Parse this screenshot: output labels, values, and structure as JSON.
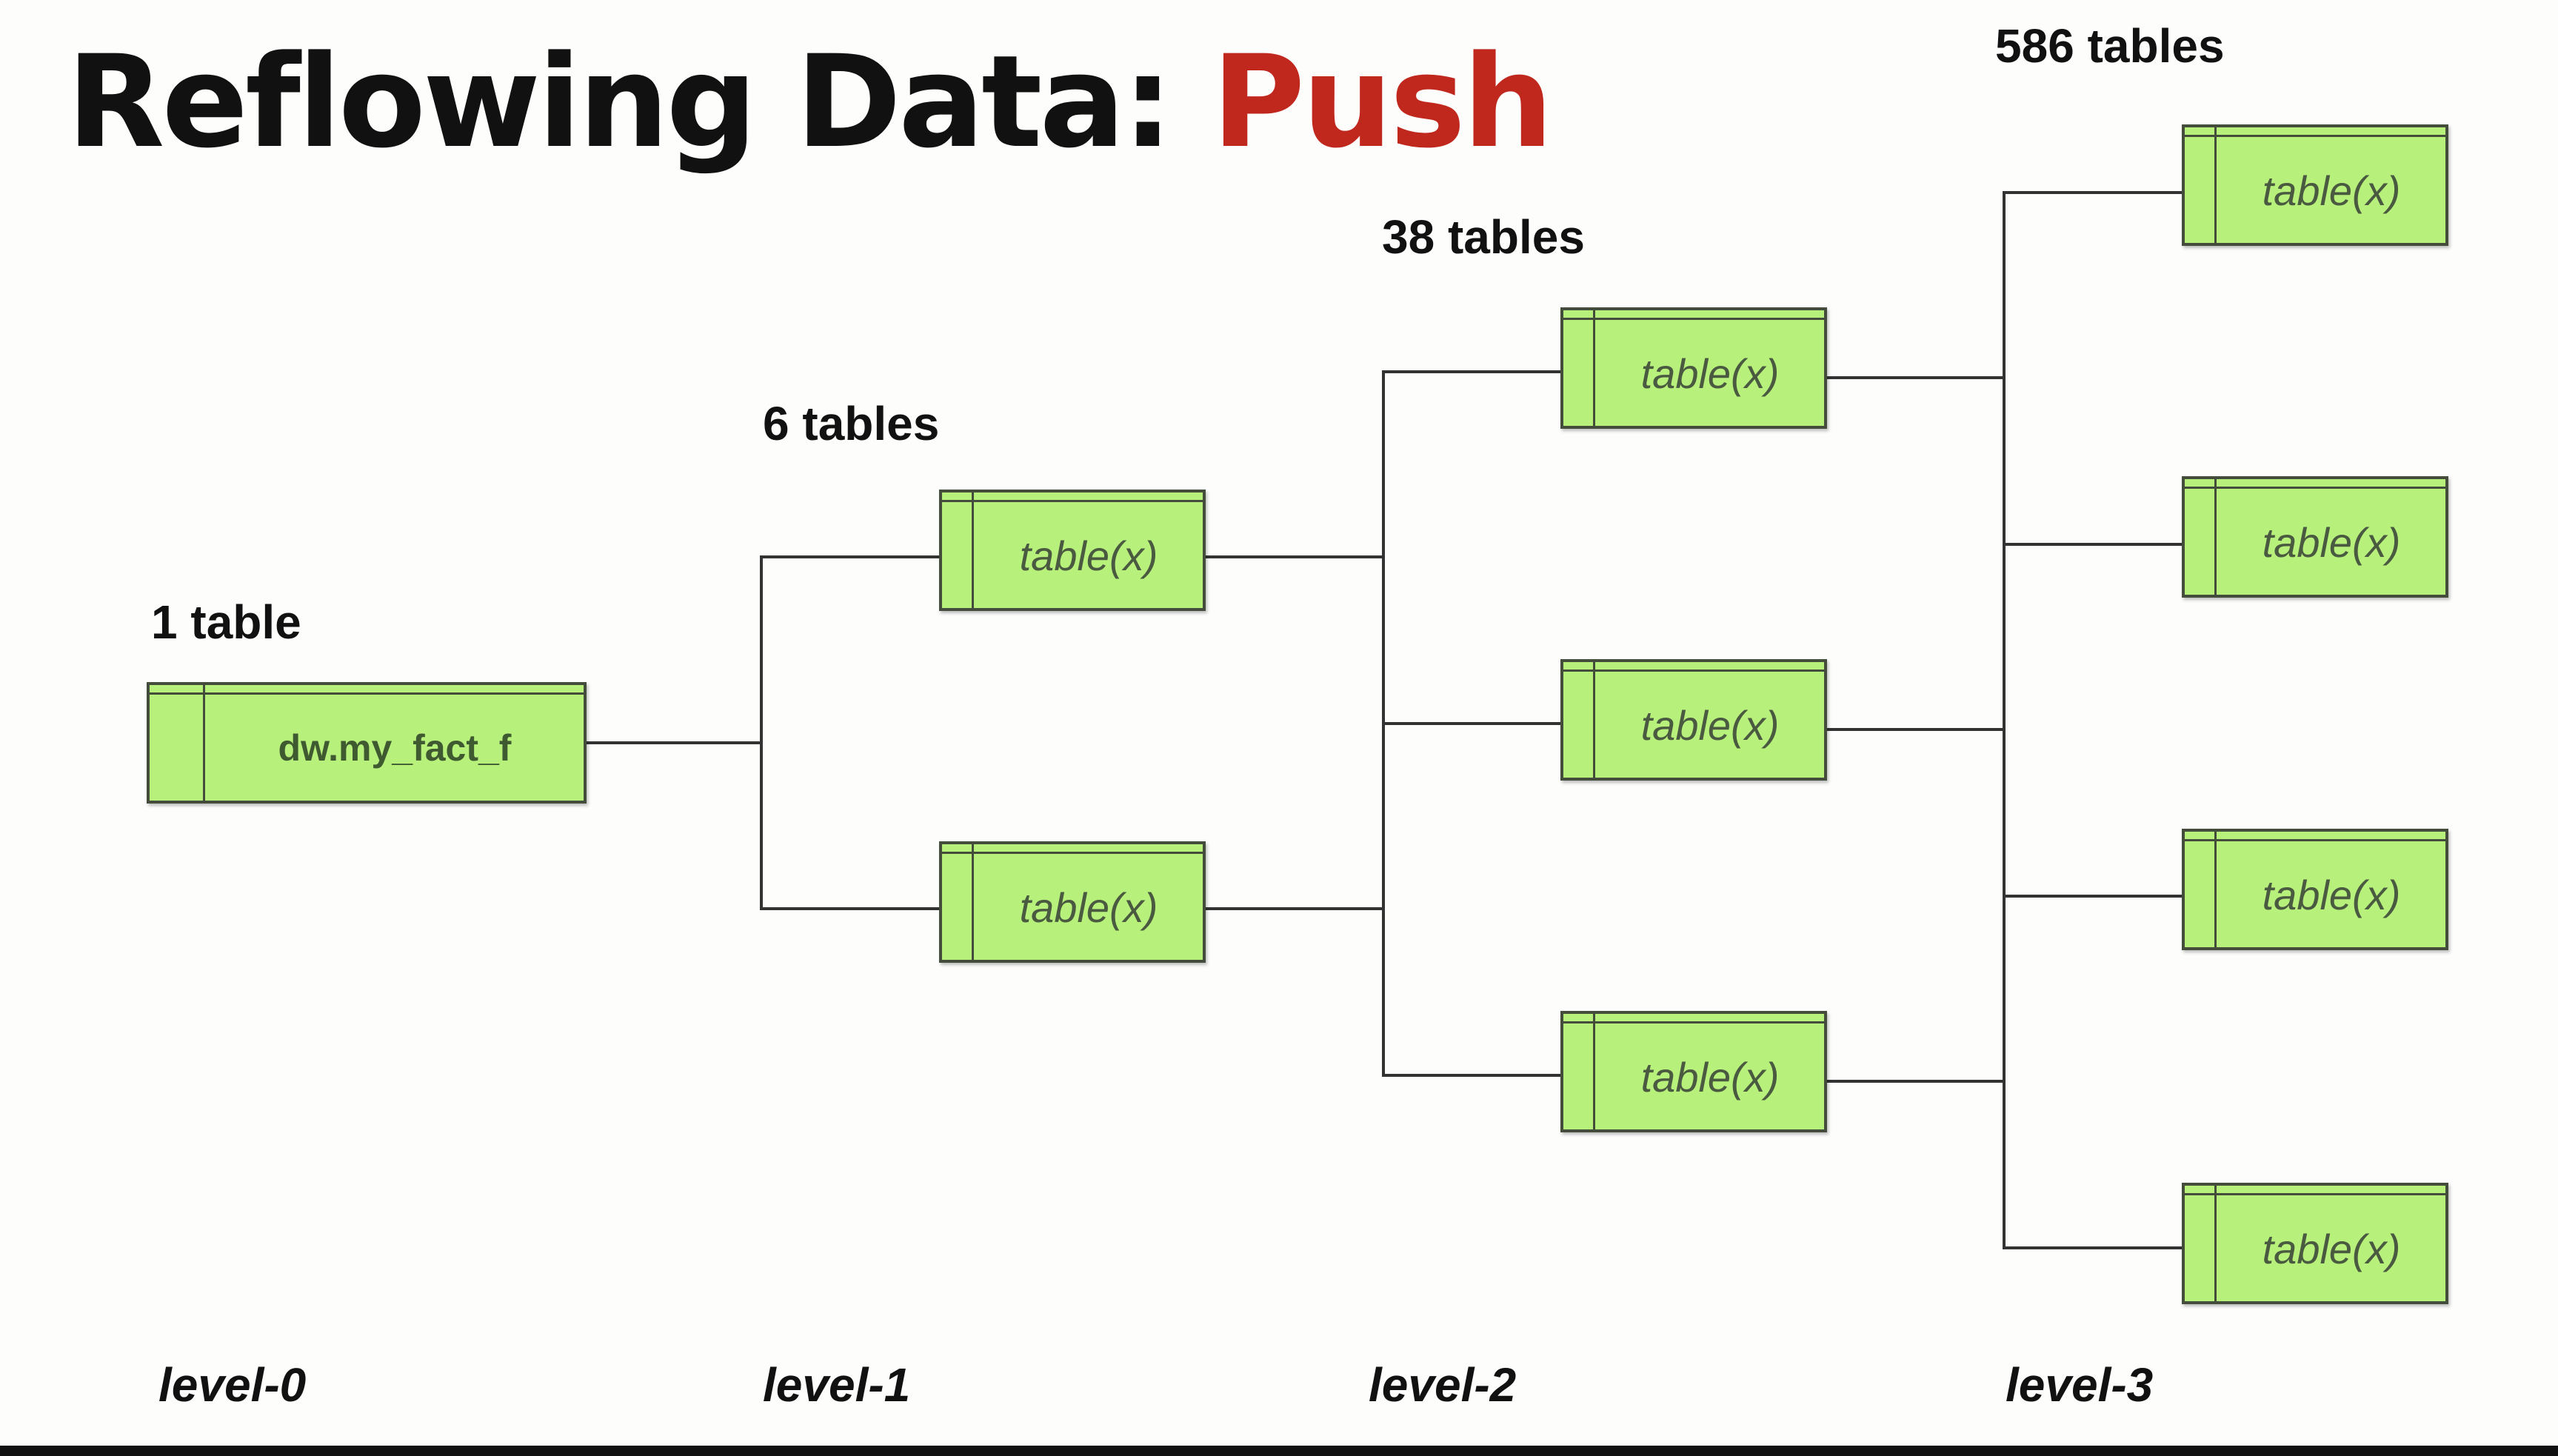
{
  "title": {
    "main": "Reflowing Data: ",
    "accent": "Push",
    "accent_color": "#c0281e"
  },
  "counts": {
    "level0": "1 table",
    "level1": "6 tables",
    "level2": "38 tables",
    "level3": "586 tables"
  },
  "levels": {
    "level0": "level-0",
    "level1": "level-1",
    "level2": "level-2",
    "level3": "level-3"
  },
  "nodes": {
    "root": "dw.my_fact_f",
    "child": "table(x)"
  },
  "colors": {
    "node_fill": "#b8f07c",
    "node_border": "#444c3c",
    "connector": "#333333"
  }
}
